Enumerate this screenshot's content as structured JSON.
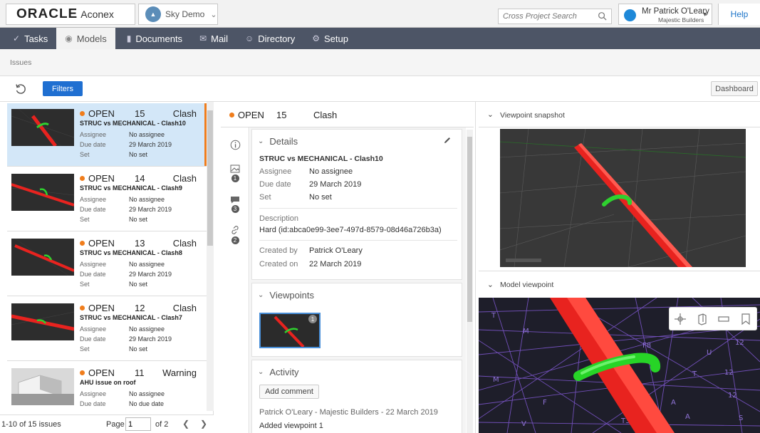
{
  "brand": {
    "oracle": "ORACLE",
    "product": "Aconex"
  },
  "project": {
    "name": "Sky Demo"
  },
  "search": {
    "placeholder": "Cross Project Search"
  },
  "user": {
    "name": "Mr Patrick O'Leary",
    "company": "Majestic Builders"
  },
  "help_label": "Help",
  "nav": [
    {
      "label": "Tasks",
      "icon": "check-icon"
    },
    {
      "label": "Models",
      "icon": "cube-icon"
    },
    {
      "label": "Documents",
      "icon": "document-icon"
    },
    {
      "label": "Mail",
      "icon": "mail-icon"
    },
    {
      "label": "Directory",
      "icon": "people-icon"
    },
    {
      "label": "Setup",
      "icon": "gear-icon"
    }
  ],
  "breadcrumb": "Issues",
  "toolbar": {
    "filters_label": "Filters",
    "dashboard_label": "Dashboard"
  },
  "issues": [
    {
      "status": "OPEN",
      "number": "15",
      "type": "Clash",
      "title": "STRUC vs MECHANICAL - Clash10",
      "assignee_label": "Assignee",
      "assignee": "No assignee",
      "due_label": "Due date",
      "due": "29 March 2019",
      "set_label": "Set",
      "set": "No set"
    },
    {
      "status": "OPEN",
      "number": "14",
      "type": "Clash",
      "title": "STRUC vs MECHANICAL - Clash9",
      "assignee_label": "Assignee",
      "assignee": "No assignee",
      "due_label": "Due date",
      "due": "29 March 2019",
      "set_label": "Set",
      "set": "No set"
    },
    {
      "status": "OPEN",
      "number": "13",
      "type": "Clash",
      "title": "STRUC vs MECHANICAL - Clash8",
      "assignee_label": "Assignee",
      "assignee": "No assignee",
      "due_label": "Due date",
      "due": "29 March 2019",
      "set_label": "Set",
      "set": "No set"
    },
    {
      "status": "OPEN",
      "number": "12",
      "type": "Clash",
      "title": "STRUC vs MECHANICAL - Clash7",
      "assignee_label": "Assignee",
      "assignee": "No assignee",
      "due_label": "Due date",
      "due": "29 March 2019",
      "set_label": "Set",
      "set": "No set"
    },
    {
      "status": "OPEN",
      "number": "11",
      "type": "Warning",
      "title": "AHU issue on roof",
      "assignee_label": "Assignee",
      "assignee": "No assignee",
      "due_label": "Due date",
      "due": "No due date"
    }
  ],
  "pager": {
    "count": "1-10 of 15 issues",
    "page_label": "Page",
    "page": "1",
    "of": "of 2"
  },
  "detail": {
    "status": "OPEN",
    "number": "15",
    "type": "Clash",
    "tabs": [
      {
        "icon": "info-icon"
      },
      {
        "icon": "image-icon",
        "badge": "1"
      },
      {
        "icon": "comment-icon",
        "badge": "3"
      },
      {
        "icon": "link-icon",
        "badge": "2"
      }
    ],
    "details_label": "Details",
    "title": "STRUC vs MECHANICAL - Clash10",
    "assignee_label": "Assignee",
    "assignee": "No assignee",
    "due_label": "Due date",
    "due": "29 March 2019",
    "set_label": "Set",
    "set": "No set",
    "description_label": "Description",
    "description": "Hard (id:abca0e99-3ee7-497d-8579-08d46a726b3a)",
    "created_by_label": "Created by",
    "created_by": "Patrick O'Leary",
    "created_on_label": "Created on",
    "created_on": "22 March 2019",
    "viewpoints_label": "Viewpoints",
    "viewpoint_badge": "1",
    "activity_label": "Activity",
    "add_comment_label": "Add comment",
    "activity_author": "Patrick O'Leary - Majestic Builders - 22 March 2019",
    "activity_text": "Added viewpoint 1"
  },
  "viewer": {
    "snapshot_label": "Viewpoint snapshot",
    "model_label": "Model viewpoint"
  },
  "colors": {
    "nav_bg": "#4d5566",
    "accent_blue": "#1f6fd1",
    "status_orange": "#f07d1c",
    "selected_row": "#d3e7f8",
    "clash_red": "#e8231f",
    "clash_green": "#2fd12f"
  }
}
